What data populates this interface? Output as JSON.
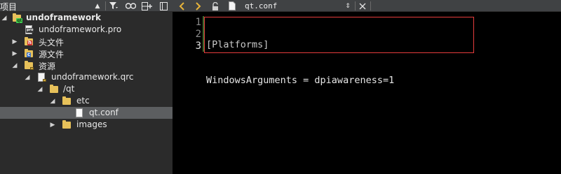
{
  "project_pane": {
    "title": "项目",
    "toolbar_icons": [
      "chevron-updown-icon",
      "filter-icon",
      "link-icon",
      "split-add-icon",
      "close-pane-icon"
    ]
  },
  "tree": [
    {
      "label": "undoframework",
      "bold": true,
      "icon": "qt-project-folder-icon",
      "expanded": true
    },
    {
      "label": "undoframework.pro",
      "icon": "pro-file-icon"
    },
    {
      "label": "头文件",
      "icon": "header-folder-icon",
      "expanded": false
    },
    {
      "label": "源文件",
      "icon": "source-folder-icon",
      "expanded": false
    },
    {
      "label": "资源",
      "icon": "resource-folder-icon",
      "expanded": true
    },
    {
      "label": "undoframework.qrc",
      "icon": "qrc-file-icon",
      "expanded": true
    },
    {
      "label": "/qt",
      "icon": "folder-icon",
      "expanded": true
    },
    {
      "label": "etc",
      "icon": "folder-icon",
      "expanded": true
    },
    {
      "label": "qt.conf",
      "icon": "file-icon",
      "selected": true
    },
    {
      "label": "images",
      "icon": "folder-icon",
      "expanded": false
    }
  ],
  "editor": {
    "file_name": "qt.conf",
    "toolbar_icons": [
      "back-icon",
      "forward-icon",
      "lock-icon",
      "file-icon",
      "dropdown-icon",
      "close-icon"
    ],
    "line_numbers": [
      "1",
      "2",
      "3"
    ],
    "current_line": 3,
    "lines": [
      "[Platforms]",
      "WindowsArguments = dpiawareness=1",
      ""
    ]
  },
  "colors": {
    "pane_bg": "#2b2b2b",
    "toolbar_bg": "#404244",
    "editor_bg": "#000000",
    "selection": "#5c5e60",
    "highlight_border": "#e63c3c",
    "nav_arrow": "#e8b43a"
  }
}
